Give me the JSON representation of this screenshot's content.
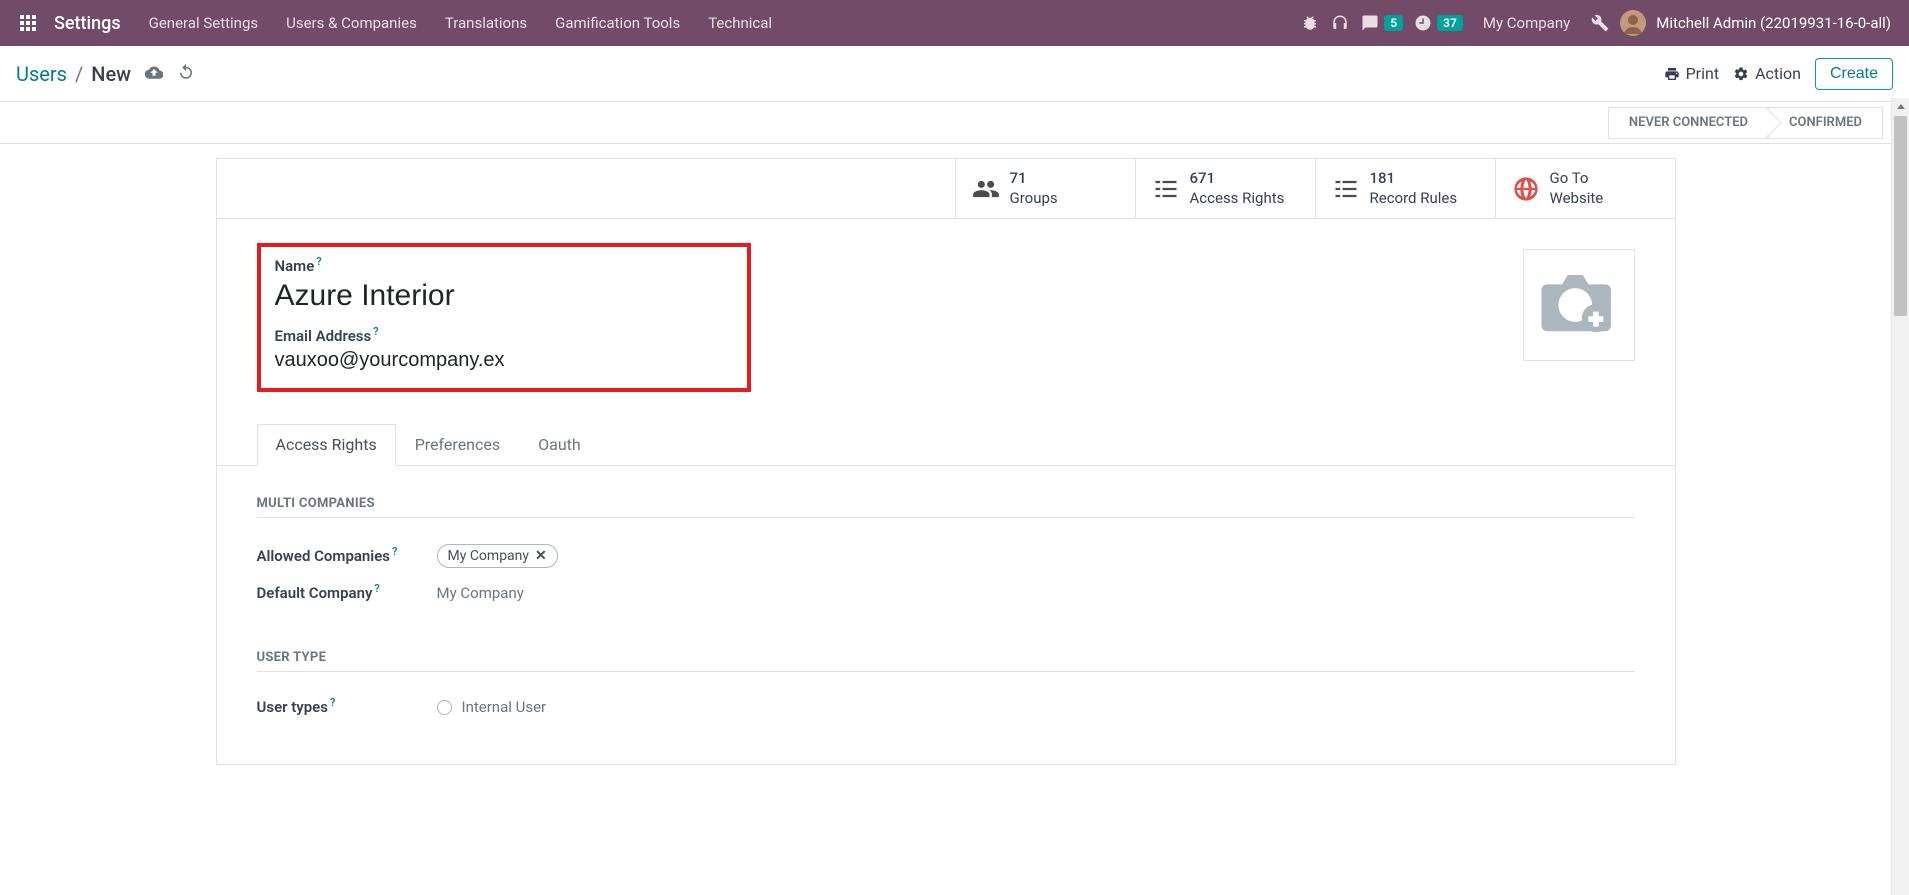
{
  "navbar": {
    "title": "Settings",
    "menu": [
      "General Settings",
      "Users & Companies",
      "Translations",
      "Gamification Tools",
      "Technical"
    ],
    "chat_badge": "5",
    "clock_badge": "37",
    "company": "My Company",
    "username": "Mitchell Admin (22019931-16-0-all)"
  },
  "breadcrumb": {
    "link": "Users",
    "current": "New"
  },
  "actions": {
    "print": "Print",
    "action": "Action",
    "create": "Create"
  },
  "status": {
    "never": "NEVER CONNECTED",
    "confirmed": "CONFIRMED"
  },
  "stats": {
    "groups": {
      "n": "71",
      "label": "Groups"
    },
    "access": {
      "n": "671",
      "label": "Access Rights"
    },
    "rules": {
      "n": "181",
      "label": "Record Rules"
    },
    "goto": {
      "line1": "Go To",
      "line2": "Website"
    }
  },
  "form": {
    "name_label": "Name",
    "name_value": "Azure Interior",
    "email_label": "Email Address",
    "email_value": "vauxoo@yourcompany.ex"
  },
  "tabs": {
    "access": "Access Rights",
    "prefs": "Preferences",
    "oauth": "Oauth"
  },
  "sections": {
    "multi": "MULTI COMPANIES",
    "allowed": "Allowed Companies",
    "allowed_tag": "My Company",
    "default": "Default Company",
    "default_val": "My Company",
    "usertype": "USER TYPE",
    "usertypes_lbl": "User types",
    "internal": "Internal User"
  }
}
